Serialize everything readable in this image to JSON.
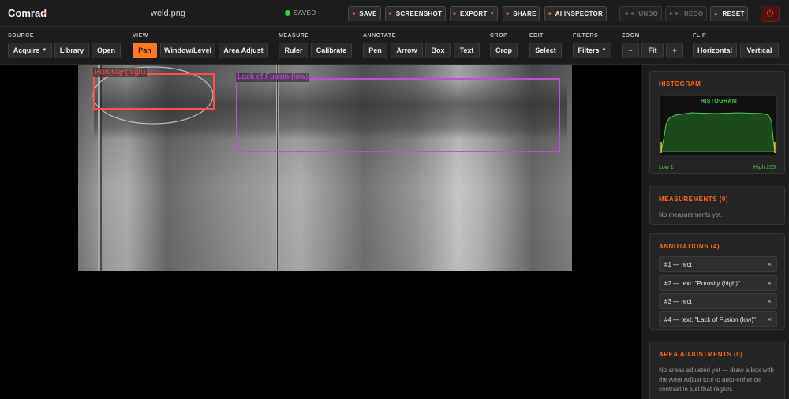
{
  "app": {
    "name": "Comrad",
    "filename": "weld.png",
    "status": "SAVED"
  },
  "top_buttons": {
    "save": "SAVE",
    "screenshot": "SCREENSHOT",
    "export": "EXPORT",
    "share": "SHARE",
    "ai_inspector": "AI INSPECTOR",
    "undo": "UNDO",
    "redo": "REDO",
    "reset": "RESET"
  },
  "toolbar": {
    "source": {
      "label": "SOURCE",
      "buttons": [
        "Acquire",
        "Library",
        "Open"
      ]
    },
    "view": {
      "label": "VIEW",
      "buttons": [
        "Pan",
        "Window/Level",
        "Area Adjust"
      ],
      "active": "Pan"
    },
    "measure": {
      "label": "MEASURE",
      "buttons": [
        "Ruler",
        "Calibrate"
      ]
    },
    "annotate": {
      "label": "ANNOTATE",
      "buttons": [
        "Pen",
        "Arrow",
        "Box",
        "Text"
      ]
    },
    "crop": {
      "label": "CROP",
      "buttons": [
        "Crop"
      ]
    },
    "edit": {
      "label": "EDIT",
      "buttons": [
        "Select"
      ]
    },
    "filters": {
      "label": "FILTERS",
      "buttons": [
        "Filters"
      ]
    },
    "zoom": {
      "label": "ZOOM",
      "buttons": [
        "−",
        "Fit",
        "+"
      ]
    },
    "flip": {
      "label": "FLIP",
      "buttons": [
        "Horizontal",
        "Vertical"
      ]
    }
  },
  "canvas": {
    "annotations": [
      {
        "label": "Porosity (high)",
        "color": "#ff4d4d"
      },
      {
        "label": "Lack of Fusion (low)",
        "color": "#c14de0"
      }
    ]
  },
  "sidebar": {
    "histogram": {
      "title": "HISTOGRAM",
      "chart_title": "HISTOGRAM",
      "low": "Low 1",
      "high": "High 255"
    },
    "measurements": {
      "title": "MEASUREMENTS (0)",
      "empty": "No measurements yet."
    },
    "annotations": {
      "title": "ANNOTATIONS (4)",
      "items": [
        "#1 — rect",
        "#2 — text: \"Porosity (high)\"",
        "#3 — rect",
        "#4 — text: \"Lack of Fusion (low)\""
      ]
    },
    "area_adjustments": {
      "title": "AREA ADJUSTMENTS (0)",
      "text_lines": [
        "No areas adjusted yet — draw a box with",
        "the Area Adjust tool to auto-enhance",
        "contrast in just that region."
      ]
    }
  },
  "colors": {
    "accent": "#ff6a1a",
    "saved_dot": "#2ecc55",
    "histogram": "#4ecb4e"
  }
}
